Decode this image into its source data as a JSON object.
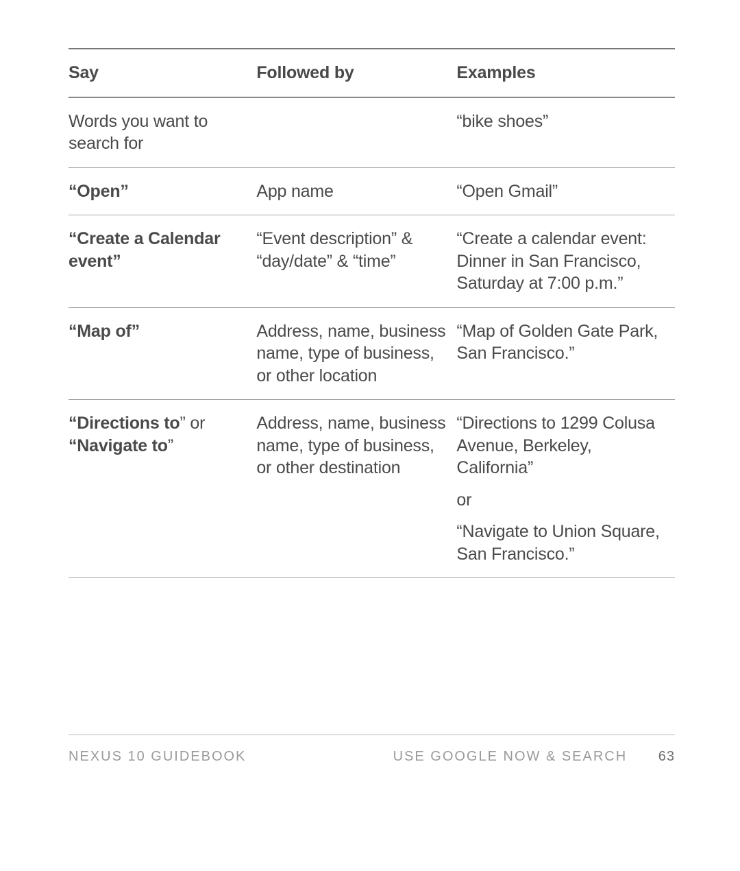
{
  "headers": {
    "say": "Say",
    "followed_by": "Followed by",
    "examples": "Examples"
  },
  "rows": [
    {
      "say_plain": "Words you want to search for",
      "followed": "",
      "examples": [
        "“bike shoes”"
      ]
    },
    {
      "say_bold": "“Open”",
      "followed": "App name",
      "examples": [
        "“Open Gmail”"
      ]
    },
    {
      "say_bold": "“Create a Calendar event”",
      "followed": "“Event descrip­tion” & “day/date” & “time”",
      "examples": [
        "“Create a calendar event: Dinner in San Francisco, Saturday at 7:00 p.m.”"
      ]
    },
    {
      "say_bold_head": "“Map of",
      "say_bold_tail": "”",
      "followed": "Address, name, business name, type of business, or other location",
      "examples": [
        "“Map of Golden Gate Park, San Francisco.”"
      ]
    },
    {
      "say_directions_a": "“Directions to",
      "say_directions_close": "”",
      "say_directions_or": " or ",
      "say_directions_b": "“Navigate to",
      "followed": "Address, name, business name, type of business, or other destination",
      "examples": [
        "“Directions to 1299 Colusa Avenue, Berkeley, California”",
        "or",
        "“Navigate to Union Square, San Francisco.”"
      ]
    }
  ],
  "footer": {
    "left": "NEXUS 10 GUIDEBOOK",
    "right": "USE GOOGLE NOW & SEARCH",
    "page": "63"
  }
}
